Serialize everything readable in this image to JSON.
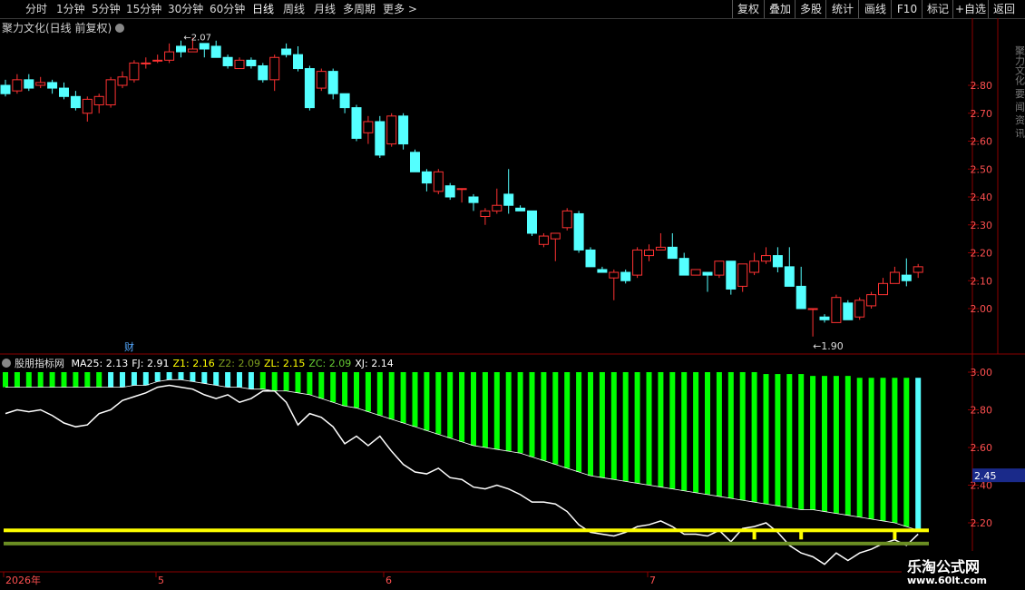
{
  "toolbar": {
    "periods": [
      "分时",
      "1分钟",
      "5分钟",
      "15分钟",
      "30分钟",
      "60分钟",
      "日线",
      "周线",
      "月线",
      "多周期",
      "更多 >"
    ],
    "active_period": "日线",
    "right_buttons": [
      "复权",
      "叠加",
      "多股",
      "统计",
      "画线",
      "F10",
      "标记",
      "+自选",
      "返回"
    ]
  },
  "stock": {
    "title": "聚力文化(日线 前复权)",
    "high_marker": "2.07",
    "low_marker": "1.90",
    "finance_marker": "财"
  },
  "indicator": {
    "name": "股朋指标网",
    "items": [
      {
        "label": "MA25: 2.13",
        "color": "#ffffff"
      },
      {
        "label": "FJ: 2.91",
        "color": "#ffffff"
      },
      {
        "label": "Z1: 2.16",
        "color": "#ffff00"
      },
      {
        "label": "Z2: 2.09",
        "color": "#7f9f1f"
      },
      {
        "label": "ZL: 2.15",
        "color": "#ffff00"
      },
      {
        "label": "ZC: 2.09",
        "color": "#66cc33"
      },
      {
        "label": "XJ: 2.14",
        "color": "#ffffff"
      }
    ],
    "current_value_tag": "2.45"
  },
  "price_axis": [
    "2.80",
    "2.70",
    "2.60",
    "2.50",
    "2.40",
    "2.30",
    "2.20",
    "2.10",
    "2.00"
  ],
  "indicator_axis": [
    "3.00",
    "2.80",
    "2.60",
    "2.40",
    "2.20"
  ],
  "date_axis": [
    "2026年",
    "5",
    "6",
    "7"
  ],
  "side_text": "聚力文化 要 闻 资 讯",
  "watermark": {
    "line1": "乐淘公式网",
    "line2": "www.60lt.com"
  },
  "colors": {
    "up": "#ff3232",
    "down": "#54ffff",
    "grid": "#8b0000",
    "bars_green": "#00ff00",
    "bars_cyan": "#54ffff",
    "yellow": "#ffff00",
    "olive": "#6b8e23"
  },
  "chart_data": {
    "type": "candlestick",
    "candles": [
      [
        2.8,
        2.77,
        2.82,
        2.76
      ],
      [
        2.78,
        2.82,
        2.84,
        2.77
      ],
      [
        2.82,
        2.79,
        2.84,
        2.78
      ],
      [
        2.8,
        2.81,
        2.83,
        2.79
      ],
      [
        2.81,
        2.79,
        2.82,
        2.77
      ],
      [
        2.79,
        2.76,
        2.81,
        2.75
      ],
      [
        2.76,
        2.72,
        2.78,
        2.71
      ],
      [
        2.7,
        2.75,
        2.76,
        2.67
      ],
      [
        2.73,
        2.76,
        2.77,
        2.7
      ],
      [
        2.73,
        2.82,
        2.83,
        2.72
      ],
      [
        2.8,
        2.83,
        2.85,
        2.79
      ],
      [
        2.82,
        2.88,
        2.89,
        2.81
      ],
      [
        2.88,
        2.88,
        2.9,
        2.86
      ],
      [
        2.89,
        2.89,
        2.91,
        2.88
      ],
      [
        2.89,
        2.92,
        2.95,
        2.88
      ],
      [
        2.94,
        2.92,
        2.96,
        2.9
      ],
      [
        2.92,
        2.93,
        2.97,
        2.92
      ],
      [
        2.95,
        2.93,
        2.95,
        2.9
      ],
      [
        2.94,
        2.9,
        2.96,
        2.9
      ],
      [
        2.9,
        2.87,
        2.91,
        2.86
      ],
      [
        2.86,
        2.89,
        2.9,
        2.86
      ],
      [
        2.89,
        2.87,
        2.9,
        2.86
      ],
      [
        2.87,
        2.82,
        2.88,
        2.81
      ],
      [
        2.82,
        2.9,
        2.91,
        2.78
      ],
      [
        2.93,
        2.91,
        2.95,
        2.9
      ],
      [
        2.91,
        2.86,
        2.94,
        2.85
      ],
      [
        2.86,
        2.72,
        2.87,
        2.71
      ],
      [
        2.79,
        2.85,
        2.86,
        2.78
      ],
      [
        2.85,
        2.77,
        2.86,
        2.75
      ],
      [
        2.77,
        2.72,
        2.77,
        2.7
      ],
      [
        2.72,
        2.61,
        2.73,
        2.6
      ],
      [
        2.63,
        2.67,
        2.69,
        2.59
      ],
      [
        2.67,
        2.55,
        2.69,
        2.54
      ],
      [
        2.59,
        2.69,
        2.7,
        2.58
      ],
      [
        2.69,
        2.59,
        2.7,
        2.57
      ],
      [
        2.56,
        2.49,
        2.57,
        2.49
      ],
      [
        2.49,
        2.45,
        2.5,
        2.42
      ],
      [
        2.42,
        2.49,
        2.5,
        2.41
      ],
      [
        2.44,
        2.4,
        2.45,
        2.39
      ],
      [
        2.43,
        2.43,
        2.43,
        2.38
      ],
      [
        2.4,
        2.38,
        2.41,
        2.35
      ],
      [
        2.33,
        2.35,
        2.36,
        2.3
      ],
      [
        2.35,
        2.37,
        2.43,
        2.34
      ],
      [
        2.41,
        2.37,
        2.5,
        2.34
      ],
      [
        2.36,
        2.35,
        2.37,
        2.35
      ],
      [
        2.35,
        2.27,
        2.35,
        2.26
      ],
      [
        2.23,
        2.26,
        2.27,
        2.22
      ],
      [
        2.25,
        2.27,
        2.27,
        2.17
      ],
      [
        2.29,
        2.35,
        2.36,
        2.28
      ],
      [
        2.34,
        2.21,
        2.35,
        2.2
      ],
      [
        2.21,
        2.15,
        2.22,
        2.15
      ],
      [
        2.14,
        2.13,
        2.15,
        2.13
      ],
      [
        2.11,
        2.13,
        2.14,
        2.03
      ],
      [
        2.13,
        2.1,
        2.14,
        2.09
      ],
      [
        2.12,
        2.21,
        2.22,
        2.11
      ],
      [
        2.19,
        2.21,
        2.23,
        2.17
      ],
      [
        2.21,
        2.22,
        2.27,
        2.21
      ],
      [
        2.22,
        2.18,
        2.27,
        2.18
      ],
      [
        2.18,
        2.12,
        2.2,
        2.12
      ],
      [
        2.12,
        2.14,
        2.14,
        2.13
      ],
      [
        2.13,
        2.12,
        2.12,
        2.06
      ],
      [
        2.12,
        2.17,
        2.17,
        2.11
      ],
      [
        2.17,
        2.07,
        2.17,
        2.05
      ],
      [
        2.08,
        2.16,
        2.16,
        2.06
      ],
      [
        2.13,
        2.17,
        2.2,
        2.12
      ],
      [
        2.17,
        2.19,
        2.22,
        2.16
      ],
      [
        2.19,
        2.15,
        2.22,
        2.13
      ],
      [
        2.15,
        2.08,
        2.22,
        2.08
      ],
      [
        2.08,
        2.0,
        2.15,
        2.0
      ],
      [
        2.0,
        2.0,
        2.0,
        1.9
      ],
      [
        1.97,
        1.96,
        1.98,
        1.95
      ],
      [
        1.95,
        2.04,
        2.05,
        1.95
      ],
      [
        2.02,
        1.96,
        2.03,
        1.96
      ],
      [
        1.97,
        2.03,
        2.04,
        1.96
      ],
      [
        2.01,
        2.05,
        2.06,
        2.0
      ],
      [
        2.05,
        2.09,
        2.11,
        2.05
      ],
      [
        2.09,
        2.13,
        2.15,
        2.09
      ],
      [
        2.12,
        2.1,
        2.18,
        2.08
      ],
      [
        2.13,
        2.15,
        2.16,
        2.11
      ]
    ],
    "xj": [
      2.78,
      2.8,
      2.79,
      2.8,
      2.77,
      2.73,
      2.71,
      2.72,
      2.78,
      2.8,
      2.85,
      2.87,
      2.89,
      2.92,
      2.93,
      2.92,
      2.91,
      2.88,
      2.86,
      2.88,
      2.84,
      2.86,
      2.9,
      2.9,
      2.84,
      2.72,
      2.78,
      2.76,
      2.71,
      2.62,
      2.66,
      2.61,
      2.66,
      2.58,
      2.51,
      2.47,
      2.46,
      2.49,
      2.44,
      2.43,
      2.39,
      2.38,
      2.4,
      2.38,
      2.35,
      2.31,
      2.31,
      2.3,
      2.26,
      2.19,
      2.15,
      2.14,
      2.13,
      2.15,
      2.18,
      2.19,
      2.21,
      2.18,
      2.14,
      2.14,
      2.13,
      2.16,
      2.1,
      2.17,
      2.18,
      2.2,
      2.15,
      2.08,
      2.04,
      2.02,
      1.98,
      2.04,
      2.0,
      2.04,
      2.06,
      2.09,
      2.11,
      2.08,
      2.14
    ],
    "fj": [
      2.92,
      2.92,
      2.92,
      2.92,
      2.92,
      2.92,
      2.92,
      2.92,
      2.92,
      2.92,
      2.92,
      2.93,
      2.93,
      2.95,
      2.96,
      2.96,
      2.95,
      2.94,
      2.93,
      2.92,
      2.92,
      2.91,
      2.91,
      2.9,
      2.9,
      2.89,
      2.88,
      2.86,
      2.84,
      2.82,
      2.81,
      2.79,
      2.77,
      2.75,
      2.73,
      2.71,
      2.69,
      2.67,
      2.65,
      2.63,
      2.61,
      2.6,
      2.59,
      2.58,
      2.57,
      2.55,
      2.53,
      2.51,
      2.49,
      2.47,
      2.45,
      2.44,
      2.43,
      2.42,
      2.41,
      2.4,
      2.39,
      2.38,
      2.37,
      2.36,
      2.35,
      2.34,
      2.33,
      2.32,
      2.31,
      2.3,
      2.29,
      2.28,
      2.27,
      2.27,
      2.26,
      2.25,
      2.24,
      2.23,
      2.22,
      2.21,
      2.2,
      2.18,
      2.16
    ],
    "bar_top": [
      3.0,
      3.0,
      3.0,
      3.0,
      3.0,
      3.0,
      3.0,
      3.0,
      3.0,
      3.0,
      3.0,
      3.0,
      3.0,
      3.0,
      3.0,
      3.0,
      3.0,
      3.0,
      3.0,
      3.0,
      3.0,
      3.0,
      3.0,
      3.0,
      3.0,
      3.0,
      3.0,
      3.0,
      3.0,
      3.0,
      3.0,
      3.0,
      3.0,
      3.0,
      3.0,
      3.0,
      3.0,
      3.0,
      3.0,
      3.0,
      3.0,
      3.0,
      3.0,
      3.0,
      3.0,
      3.0,
      3.0,
      3.0,
      3.0,
      3.0,
      3.0,
      3.0,
      3.0,
      3.0,
      3.0,
      3.0,
      3.0,
      3.0,
      3.0,
      3.0,
      3.0,
      3.0,
      3.0,
      3.0,
      3.0,
      2.99,
      2.99,
      2.99,
      2.99,
      2.98,
      2.98,
      2.98,
      2.98,
      2.97,
      2.97,
      2.97,
      2.97,
      2.97,
      2.97
    ],
    "z1": 2.16,
    "z2": 2.09,
    "price_range": [
      1.86,
      2.98
    ],
    "indicator_range": [
      2.05,
      3.05
    ]
  }
}
